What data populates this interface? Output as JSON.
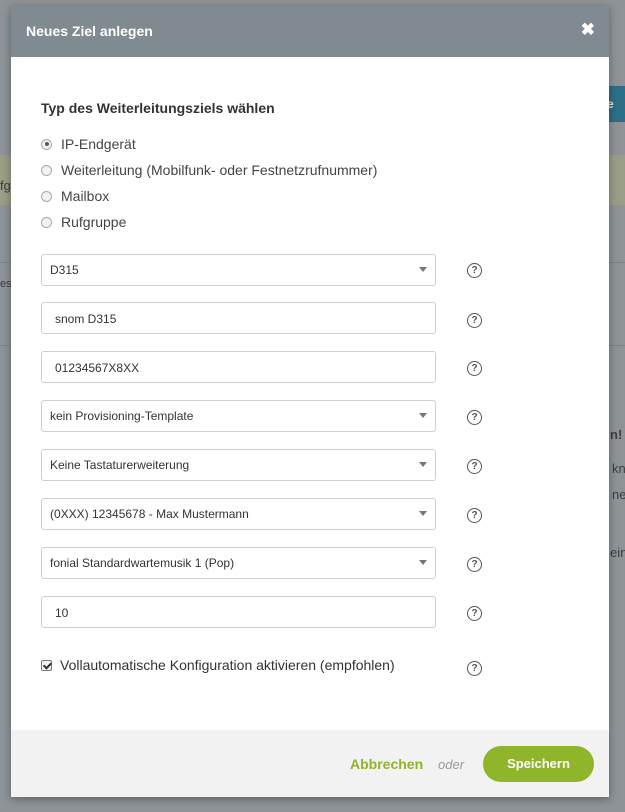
{
  "background": {
    "button_fragment": "fe",
    "fragments": [
      "fg",
      "es",
      "n!",
      "kn",
      "ne",
      "ein"
    ]
  },
  "modal": {
    "title": "Neues Ziel anlegen",
    "close_icon": "close-icon",
    "section_title": "Typ des Weiterleitungsziels wählen",
    "radio_options": [
      {
        "label": "IP-Endgerät",
        "checked": true
      },
      {
        "label": "Weiterleitung (Mobilfunk- oder Festnetzrufnummer)",
        "checked": false
      },
      {
        "label": "Mailbox",
        "checked": false
      },
      {
        "label": "Rufgruppe",
        "checked": false
      }
    ],
    "fields": {
      "device_model": "D315",
      "device_name": "snom D315",
      "mac_address": "01234567X8XX",
      "provisioning_template": "kein Provisioning-Template",
      "keyboard_extension": "Keine Tastaturerweiterung",
      "caller_number": "(0XXX) 12345678 - Max Mustermann",
      "hold_music": "fonial Standardwartemusik 1 (Pop)",
      "ring_time": "10"
    },
    "auto_config_label": "Vollautomatische Konfiguration aktivieren (empfohlen)",
    "auto_config_checked": true,
    "help_symbol": "?",
    "footer": {
      "cancel_label": "Abbrechen",
      "or_label": "oder",
      "save_label": "Speichern"
    }
  },
  "colors": {
    "accent": "#8fb52a",
    "header": "#7f8a91"
  }
}
